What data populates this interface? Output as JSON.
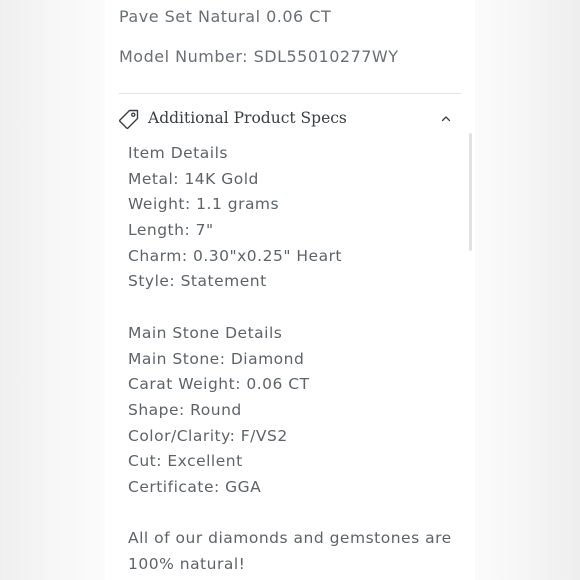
{
  "summary": {
    "line1": "Pave Set Natural 0.06 CT",
    "line2": "Model Number: SDL55010277WY"
  },
  "section": {
    "title": "Additional Product Specs",
    "icon": "tag-icon",
    "toggle_icon": "chevron-up-icon"
  },
  "specs": {
    "item_header": "Item Details",
    "metal": "Metal: 14K Gold",
    "weight": "Weight: 1.1 grams",
    "length": "Length: 7\"",
    "charm": "Charm: 0.30\"x0.25\" Heart",
    "style": "Style: Statement",
    "stone_header": "Main Stone Details",
    "main_stone": "Main Stone: Diamond",
    "carat": "Carat Weight: 0.06 CT",
    "shape": "Shape: Round",
    "color_clarity": "Color/Clarity: F/VS2",
    "cut": "Cut: Excellent",
    "certificate": "Certificate: GGA",
    "note_line1": "All of our diamonds and gemstones are",
    "note_line2": "100% natural!"
  },
  "colors": {
    "text": "#5f6368",
    "heading": "#3a3f43",
    "divider": "#e3e3e3"
  }
}
